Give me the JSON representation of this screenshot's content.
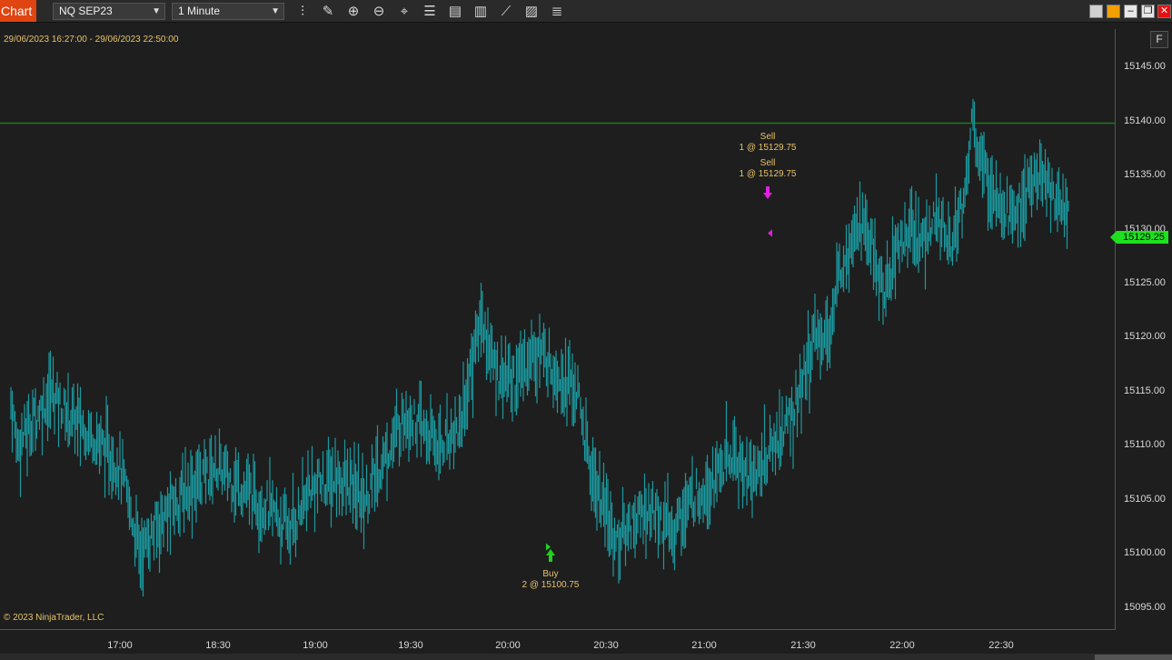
{
  "toolbar": {
    "tab_label": "Chart",
    "instrument": "NQ SEP23",
    "interval": "1 Minute",
    "icons": [
      "bars-type-icon",
      "draw-pencil-icon",
      "zoom-in-icon",
      "zoom-out-icon",
      "crosshair-icon",
      "properties-icon",
      "data-box-icon",
      "indicators-icon",
      "strategies-icon",
      "templates-icon",
      "list-icon"
    ],
    "window_buttons": [
      "minimize-icon",
      "restore-icon",
      "close-icon"
    ]
  },
  "chart": {
    "range_label": "29/06/2023 16:27:00 - 29/06/2023 22:50:00",
    "copyright": "© 2023 NinjaTrader, LLC",
    "f_button": "F",
    "last_price": "15129.25",
    "colors": {
      "bar": "#1a9aa0",
      "hline": "#1e7a1e",
      "buy": "#22d022",
      "sell": "#e020e0",
      "text": "#e8c36a",
      "last": "#1ee01e"
    }
  },
  "trades": {
    "sell1_side": "Sell",
    "sell1_qty": "1 @ 15129.75",
    "sell2_side": "Sell",
    "sell2_qty": "1 @ 15129.75",
    "buy_side": "Buy",
    "buy_qty": "2 @ 15100.75"
  },
  "chart_data": {
    "type": "ohlc",
    "ylim": [
      15092,
      15148
    ],
    "y_ticks": [
      "15145.00",
      "15140.00",
      "15135.00",
      "15130.00",
      "15125.00",
      "15120.00",
      "15115.00",
      "15110.00",
      "15105.00",
      "15100.00",
      "15095.00"
    ],
    "x_ticks": [
      "17:00",
      "18:30",
      "19:00",
      "19:30",
      "20:00",
      "20:30",
      "21:00",
      "21:30",
      "22:00",
      "22:30"
    ],
    "horizontal_line": 15139.75,
    "hi_lo_path": [
      [
        0,
        15114
      ],
      [
        5,
        15110
      ],
      [
        15,
        15112
      ],
      [
        30,
        15115
      ],
      [
        40,
        15113
      ],
      [
        60,
        15111
      ],
      [
        80,
        15108
      ],
      [
        95,
        15100
      ],
      [
        110,
        15103
      ],
      [
        130,
        15106
      ],
      [
        150,
        15108
      ],
      [
        170,
        15106
      ],
      [
        190,
        15104
      ],
      [
        205,
        15102
      ],
      [
        220,
        15106
      ],
      [
        240,
        15107
      ],
      [
        260,
        15105
      ],
      [
        275,
        15109
      ],
      [
        290,
        15113
      ],
      [
        305,
        15111
      ],
      [
        315,
        15110
      ],
      [
        330,
        15112
      ],
      [
        345,
        15122
      ],
      [
        355,
        15117
      ],
      [
        370,
        15116
      ],
      [
        385,
        15119
      ],
      [
        400,
        15117
      ],
      [
        415,
        15115
      ],
      [
        425,
        15108
      ],
      [
        435,
        15104
      ],
      [
        445,
        15101
      ],
      [
        455,
        15103
      ],
      [
        470,
        15104
      ],
      [
        485,
        15102
      ],
      [
        500,
        15105
      ],
      [
        515,
        15107
      ],
      [
        530,
        15109
      ],
      [
        545,
        15107
      ],
      [
        560,
        15110
      ],
      [
        575,
        15113
      ],
      [
        590,
        15120
      ],
      [
        600,
        15120
      ],
      [
        610,
        15127
      ],
      [
        620,
        15131
      ],
      [
        630,
        15129
      ],
      [
        640,
        15124
      ],
      [
        650,
        15128
      ],
      [
        660,
        15130
      ],
      [
        670,
        15129
      ],
      [
        680,
        15131
      ],
      [
        690,
        15129
      ],
      [
        700,
        15133
      ],
      [
        705,
        15140
      ],
      [
        715,
        15135
      ],
      [
        725,
        15133
      ],
      [
        735,
        15131
      ],
      [
        745,
        15133
      ],
      [
        755,
        15135
      ],
      [
        765,
        15133
      ],
      [
        775,
        15132
      ],
      [
        785,
        15129
      ]
    ],
    "markers": [
      {
        "side": "buy",
        "price": 15100.75
      },
      {
        "side": "sell",
        "price": 15129.75
      },
      {
        "side": "sell",
        "price": 15129.75
      }
    ]
  }
}
